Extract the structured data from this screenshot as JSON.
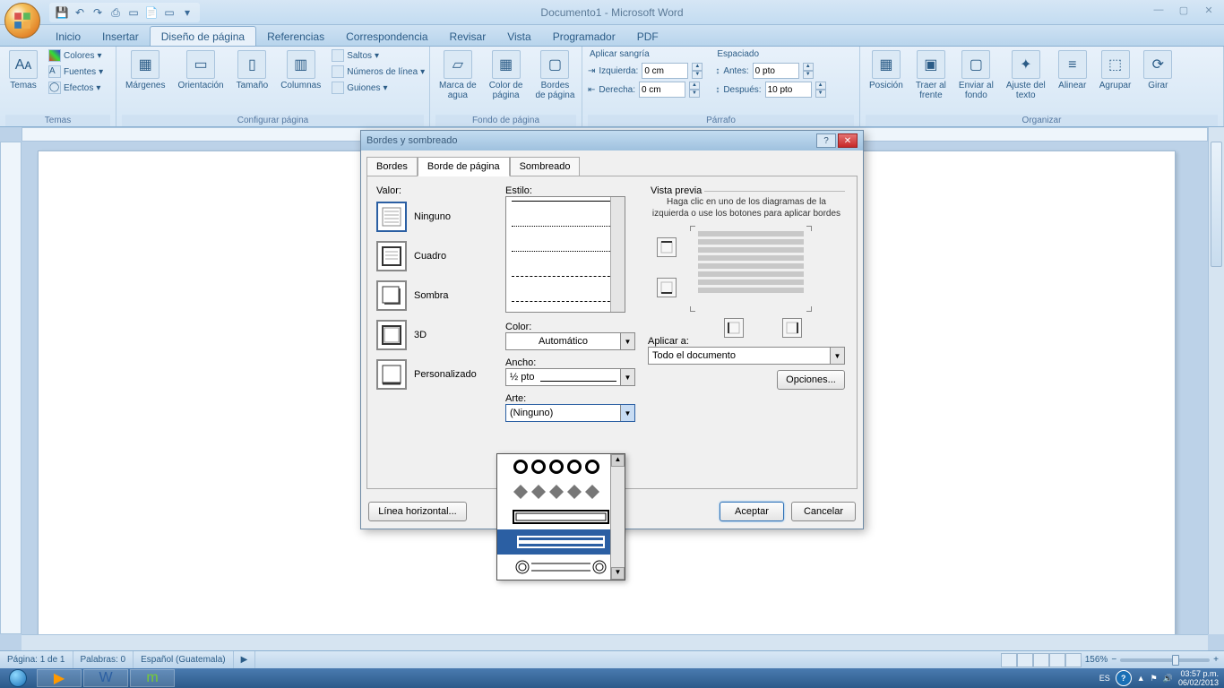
{
  "app": {
    "title": "Documento1 - Microsoft Word"
  },
  "qat_items": [
    "save",
    "undo",
    "redo",
    "print",
    "new",
    "open",
    "mail",
    "quick-print"
  ],
  "tabs": [
    "Inicio",
    "Insertar",
    "Diseño de página",
    "Referencias",
    "Correspondencia",
    "Revisar",
    "Vista",
    "Programador",
    "PDF"
  ],
  "active_tab": 2,
  "ribbon": {
    "temas": {
      "label": "Temas",
      "main": "Temas",
      "colores": "Colores",
      "fuentes": "Fuentes",
      "efectos": "Efectos"
    },
    "configurar": {
      "label": "Configurar página",
      "margenes": "Márgenes",
      "orientacion": "Orientación",
      "tamano": "Tamaño",
      "columnas": "Columnas",
      "saltos": "Saltos",
      "numeros": "Números de línea",
      "guiones": "Guiones"
    },
    "fondo": {
      "label": "Fondo de página",
      "marca": "Marca de\nagua",
      "color": "Color de\npágina",
      "bordes": "Bordes\nde página"
    },
    "sangria": {
      "title": "Aplicar sangría",
      "izq_label": "Izquierda:",
      "izq_val": "0 cm",
      "der_label": "Derecha:",
      "der_val": "0 cm"
    },
    "espaciado": {
      "title": "Espaciado",
      "antes_label": "Antes:",
      "antes_val": "0 pto",
      "despues_label": "Después:",
      "despues_val": "10 pto"
    },
    "parrafo": "Párrafo",
    "organizar": {
      "label": "Organizar",
      "posicion": "Posición",
      "traer": "Traer al\nfrente",
      "enviar": "Enviar al\nfondo",
      "ajuste": "Ajuste del\ntexto",
      "alinear": "Alinear",
      "agrupar": "Agrupar",
      "girar": "Girar"
    }
  },
  "status": {
    "page": "Página: 1 de 1",
    "words": "Palabras: 0",
    "lang": "Español (Guatemala)",
    "zoom": "156%"
  },
  "taskbar": {
    "lang": "ES",
    "time": "03:57 p.m.",
    "date": "06/02/2013"
  },
  "dialog": {
    "title": "Bordes y sombreado",
    "tabs": [
      "Bordes",
      "Borde de página",
      "Sombreado"
    ],
    "active_tab": 1,
    "valor_label": "Valor:",
    "settings": [
      "Ninguno",
      "Cuadro",
      "Sombra",
      "3D",
      "Personalizado"
    ],
    "estilo_label": "Estilo:",
    "color_label": "Color:",
    "color_val": "Automático",
    "ancho_label": "Ancho:",
    "ancho_val": "½ pto",
    "arte_label": "Arte:",
    "arte_val": "(Ninguno)",
    "preview_label": "Vista previa",
    "preview_hint": "Haga clic en uno de los diagramas de la izquierda o use los botones para aplicar bordes",
    "aplicar_label": "Aplicar a:",
    "aplicar_val": "Todo el documento",
    "opciones": "Opciones...",
    "hline": "Línea horizontal...",
    "aceptar": "Aceptar",
    "cancelar": "Cancelar"
  }
}
